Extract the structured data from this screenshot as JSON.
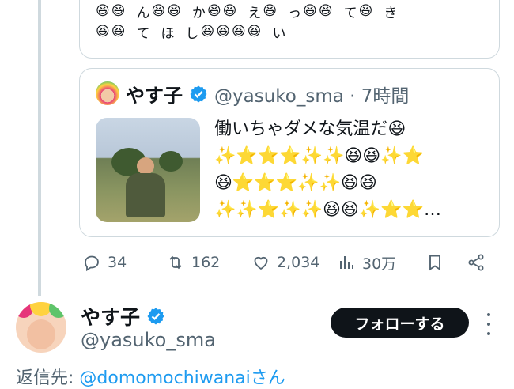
{
  "top_card": {
    "row1": [
      "😆",
      "😆",
      "ん",
      "😆",
      "😆",
      "か",
      "😆",
      "😆",
      "え",
      "😆",
      "っ",
      "😆",
      "😆",
      "て",
      "😆",
      "き"
    ],
    "row2": [
      "😆",
      "😆",
      "て",
      "ほ",
      "し",
      "😆",
      "😆",
      "😆",
      "😆",
      "い"
    ]
  },
  "quote": {
    "name": "やす子",
    "handle": "@yasuko_sma · 7時間",
    "text_lines": [
      "働いちゃダメな気温だ😆",
      "✨⭐⭐⭐✨✨😆😆✨⭐",
      "😆⭐⭐⭐✨✨😆😆",
      "✨✨⭐✨✨😆😆✨⭐⭐…"
    ]
  },
  "actions": {
    "reply": "34",
    "retweet": "162",
    "like": "2,034",
    "views": "30万"
  },
  "tweet": {
    "name": "やす子",
    "handle": "@yasuko_sma",
    "follow_label": "フォローする",
    "reply_label": "返信先: ",
    "reply_to": "@domomochiwanaiさん"
  },
  "colors": {
    "verified": "#1d9bf0",
    "link": "#1d9bf0",
    "muted": "#536471",
    "border": "#cfd9de"
  }
}
